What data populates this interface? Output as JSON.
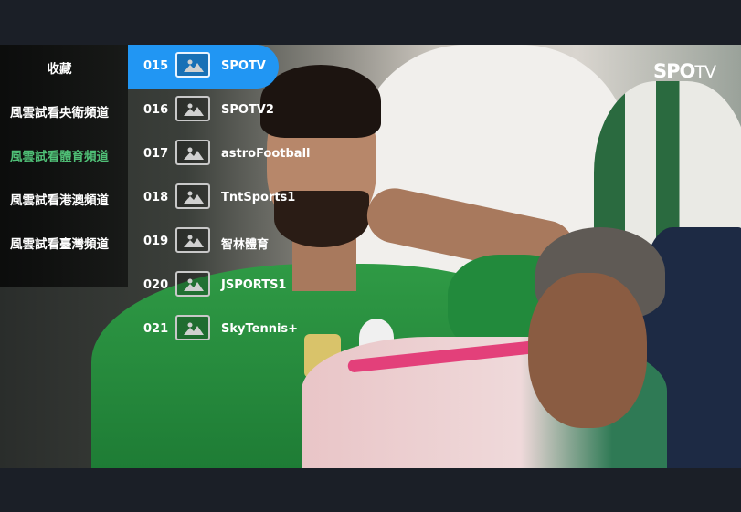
{
  "overlay_logo": {
    "main": "SPO",
    "suffix": "TV"
  },
  "categories": [
    {
      "label": "收藏"
    },
    {
      "label": "風雲試看央衛頻道"
    },
    {
      "label": "風雲試看體育頻道"
    },
    {
      "label": "風雲試看港澳頻道"
    },
    {
      "label": "風雲試看臺灣頻道"
    }
  ],
  "active_category_color": "#4fbf76",
  "selection_color": "#2196f3",
  "channels": [
    {
      "number": "015",
      "name": "SPOTV"
    },
    {
      "number": "016",
      "name": "SPOTV2"
    },
    {
      "number": "017",
      "name": "astroFootball"
    },
    {
      "number": "018",
      "name": "TntSports1"
    },
    {
      "number": "019",
      "name": "智林體育"
    },
    {
      "number": "020",
      "name": "JSPORTS1"
    },
    {
      "number": "021",
      "name": "SkyTennis+"
    }
  ],
  "thumbnail_icon": "image-placeholder-icon"
}
